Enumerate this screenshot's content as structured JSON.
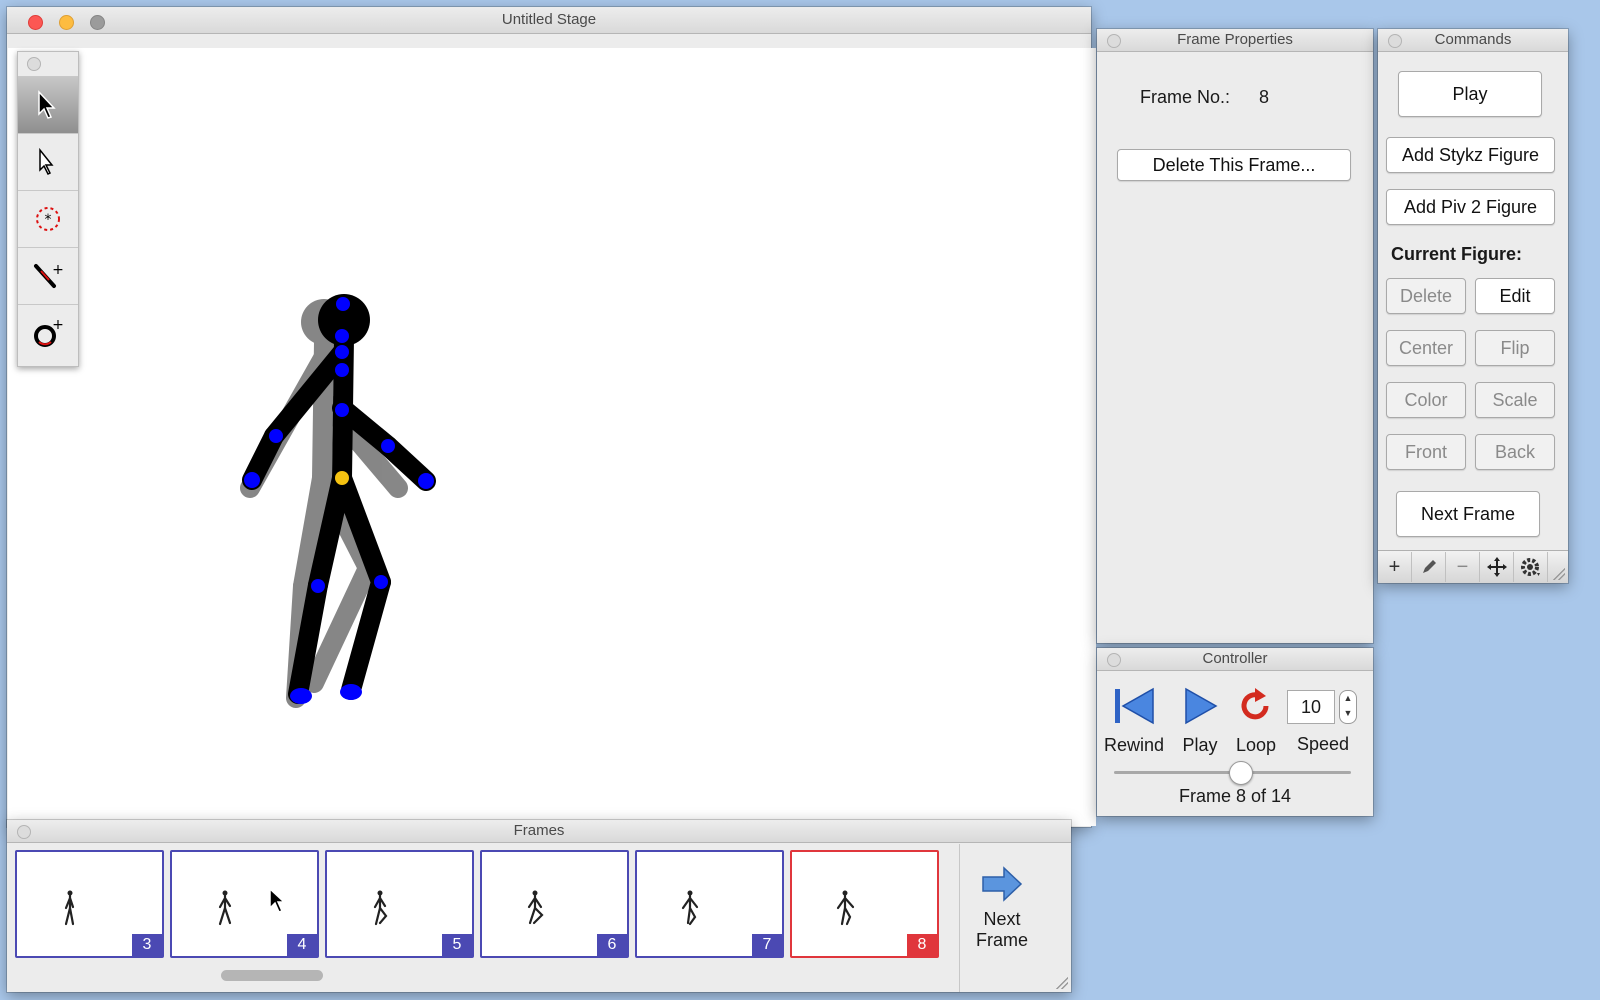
{
  "stage": {
    "title": "Untitled Stage"
  },
  "tools": [
    {
      "name": "select-tool-icon",
      "active": true
    },
    {
      "name": "pointer-tool-icon",
      "active": false
    },
    {
      "name": "center-point-tool-icon",
      "active": false
    },
    {
      "name": "add-line-tool-icon",
      "active": false
    },
    {
      "name": "add-circle-tool-icon",
      "active": false
    }
  ],
  "frame_properties": {
    "title": "Frame Properties",
    "frame_no_label": "Frame No.:",
    "frame_no_value": "8",
    "delete_button": "Delete This Frame..."
  },
  "commands": {
    "title": "Commands",
    "play": "Play",
    "add_stykz": "Add Stykz Figure",
    "add_piv2": "Add Piv 2 Figure",
    "current_figure_label": "Current Figure:",
    "delete": "Delete",
    "edit": "Edit",
    "center": "Center",
    "flip": "Flip",
    "color": "Color",
    "scale": "Scale",
    "front": "Front",
    "back": "Back",
    "next_frame": "Next Frame",
    "bar": {
      "add": "+",
      "remove": "−"
    }
  },
  "controller": {
    "title": "Controller",
    "rewind": "Rewind",
    "play": "Play",
    "loop": "Loop",
    "speed_label": "Speed",
    "speed_value": "10",
    "frame_text": "Frame 8 of 14",
    "current_frame": 8,
    "total_frames": 14
  },
  "frames": {
    "title": "Frames",
    "thumbnails": [
      {
        "number": "3",
        "selected": false
      },
      {
        "number": "4",
        "selected": false
      },
      {
        "number": "5",
        "selected": false
      },
      {
        "number": "6",
        "selected": false
      },
      {
        "number": "7",
        "selected": false
      },
      {
        "number": "8",
        "selected": true
      }
    ],
    "next_frame_line1": "Next",
    "next_frame_line2": "Frame"
  },
  "colors": {
    "joint_blue": "#0000ff",
    "origin_joint": "#f5c211",
    "selected_frame": "#e0363c",
    "frame_border": "#4b49b3"
  }
}
